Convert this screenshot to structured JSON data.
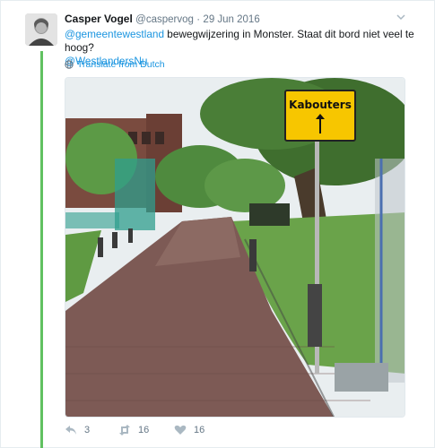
{
  "tweet": {
    "author_name": "Casper Vogel",
    "author_handle": "@caspervog",
    "separator": "·",
    "date": "29 Jun 2016",
    "text_mention": "@gemeentewestland",
    "text_body": " bewegwijzering in Monster. Staat dit bord niet veel te hoog?",
    "text_tag": "@WestlandersNu",
    "translate_label": "Translate from Dutch",
    "photo_sign_text": "Kabouters",
    "reply_count": "3",
    "retweet_count": "16",
    "like_count": "16"
  },
  "icons": {
    "more": "chevron-down-icon",
    "translate": "globe-icon",
    "reply": "reply-icon",
    "retweet": "retweet-icon",
    "like": "heart-icon"
  },
  "colors": {
    "link": "#1b95e0",
    "thread": "#61c161",
    "sign_yellow": "#f7c600",
    "muted": "#657786"
  }
}
